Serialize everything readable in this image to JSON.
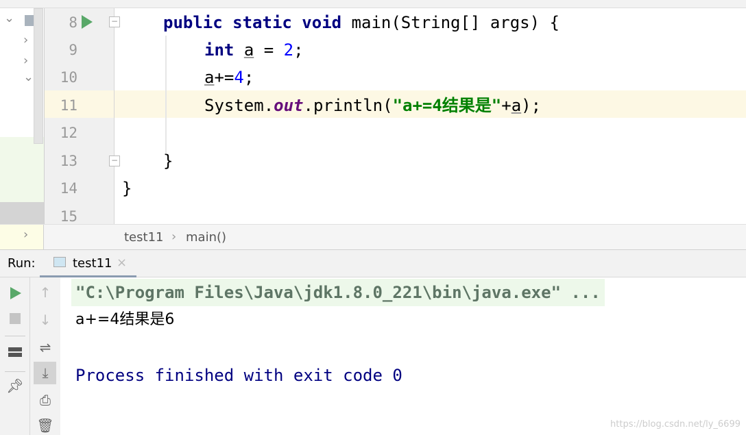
{
  "editor": {
    "line_numbers": [
      "8",
      "9",
      "10",
      "11",
      "12",
      "13",
      "14",
      "15"
    ],
    "lines": {
      "l8": {
        "kw1": "public static void",
        "rest": " main(String[] args) {"
      },
      "l9": {
        "kw": "int",
        "var": "a",
        "eq": " = ",
        "num": "2",
        "end": ";"
      },
      "l10": {
        "var": "a",
        "op": "+=",
        "num": "4",
        "end": ";"
      },
      "l11": {
        "pre": "System.",
        "field": "out",
        "mid": ".println(",
        "str": "\"a+=4结果是\"",
        "plus": "+",
        "var": "a",
        "end": ");"
      },
      "l13": "}",
      "l14": "}"
    }
  },
  "breadcrumb": {
    "class": "test11",
    "sep": "›",
    "method": "main()"
  },
  "run": {
    "label": "Run:",
    "tab": "test11",
    "close": "×"
  },
  "console": {
    "command": "\"C:\\Program Files\\Java\\jdk1.8.0_221\\bin\\java.exe\" ...",
    "output": "a+=4结果是6",
    "exit": "Process finished with exit code 0"
  },
  "watermark": "https://blog.csdn.net/ly_6699",
  "colors": {
    "keyword": "#000080",
    "number": "#0000ff",
    "string": "#008000",
    "field": "#660e7a",
    "console_blue": "#000080",
    "run_green": "#59a869"
  }
}
